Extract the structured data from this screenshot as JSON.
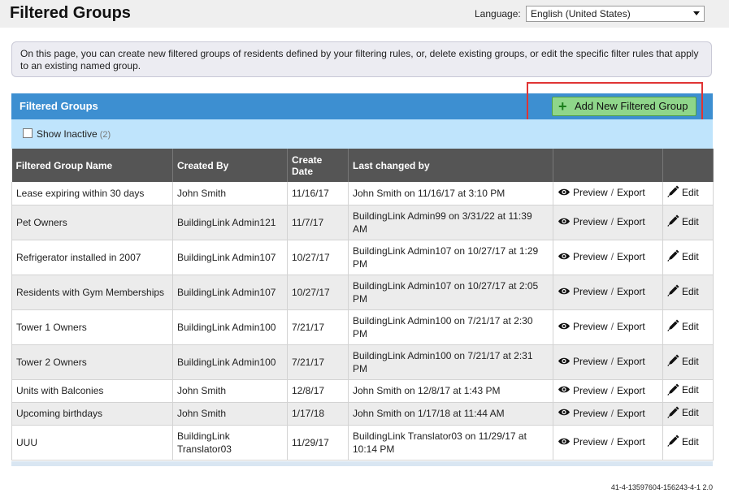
{
  "page": {
    "title": "Filtered Groups"
  },
  "language": {
    "label": "Language:",
    "selected": "English (United States)"
  },
  "info": {
    "text": "On this page, you can create new filtered groups of residents defined by your filtering rules, or, delete existing groups, or edit the specific filter rules that apply to an existing named group."
  },
  "section": {
    "title": "Filtered Groups",
    "add_button": "Add New Filtered Group"
  },
  "filter": {
    "show_inactive": "Show Inactive",
    "inactive_count": "(2)"
  },
  "table": {
    "headers": [
      "Filtered Group Name",
      "Created By",
      "Create Date",
      "Last changed by",
      "",
      ""
    ],
    "actions": {
      "preview": "Preview",
      "separator": "/",
      "export": "Export",
      "edit": "Edit"
    },
    "rows": [
      {
        "name": "Lease expiring within 30 days",
        "created_by": "John Smith",
        "date": "11/16/17",
        "last_changed": "John Smith on 11/16/17 at 3:10 PM"
      },
      {
        "name": "Pet Owners",
        "created_by": "BuildingLink Admin121",
        "date": "11/7/17",
        "last_changed": "BuildingLink Admin99 on 3/31/22 at 11:39 AM"
      },
      {
        "name": "Refrigerator installed in 2007",
        "created_by": "BuildingLink Admin107",
        "date": "10/27/17",
        "last_changed": "BuildingLink Admin107 on 10/27/17 at 1:29 PM"
      },
      {
        "name": "Residents with Gym Memberships",
        "created_by": "BuildingLink Admin107",
        "date": "10/27/17",
        "last_changed": "BuildingLink Admin107 on 10/27/17 at 2:05 PM"
      },
      {
        "name": "Tower 1 Owners",
        "created_by": "BuildingLink Admin100",
        "date": "7/21/17",
        "last_changed": "BuildingLink Admin100 on 7/21/17 at 2:30 PM"
      },
      {
        "name": "Tower 2 Owners",
        "created_by": "BuildingLink Admin100",
        "date": "7/21/17",
        "last_changed": "BuildingLink Admin100 on 7/21/17 at 2:31 PM"
      },
      {
        "name": "Units with Balconies",
        "created_by": "John Smith",
        "date": "12/8/17",
        "last_changed": "John Smith on 12/8/17 at 1:43 PM"
      },
      {
        "name": "Upcoming birthdays",
        "created_by": "John Smith",
        "date": "1/17/18",
        "last_changed": "John Smith on 1/17/18 at 11:44 AM"
      },
      {
        "name": "UUU",
        "created_by": "BuildingLink Translator03",
        "date": "11/29/17",
        "last_changed": "BuildingLink Translator03 on 11/29/17 at 10:14 PM"
      }
    ]
  },
  "footer": {
    "version": "41-4-13597604-156243-4-1 2.0"
  },
  "colors": {
    "header_blue": "#3d8fd1",
    "filter_bg": "#bfe4fc",
    "table_header": "#555555",
    "add_button": "#8fd68a",
    "highlight": "#e03434"
  }
}
